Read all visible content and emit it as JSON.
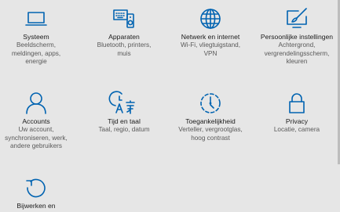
{
  "accent_color": "#0063b1",
  "tiles": [
    {
      "id": "systeem",
      "icon": "laptop-icon",
      "title": "Systeem",
      "desc": [
        "Beeldscherm,",
        "meldingen, apps,",
        "energie"
      ]
    },
    {
      "id": "apparaten",
      "icon": "keyboard-speaker-icon",
      "title": "Apparaten",
      "desc": [
        "Bluetooth, printers,",
        "muis"
      ]
    },
    {
      "id": "netwerk",
      "icon": "globe-icon",
      "title": "Netwerk en internet",
      "desc": [
        "Wi-Fi, vliegtuigstand,",
        "VPN"
      ]
    },
    {
      "id": "persoonlijk",
      "icon": "paint-monitor-icon",
      "title": "Persoonlijke instellingen",
      "desc": [
        "Achtergrond,",
        "vergrendelingsscherm,",
        "kleuren"
      ]
    },
    {
      "id": "accounts",
      "icon": "person-icon",
      "title": "Accounts",
      "desc": [
        "Uw account,",
        "synchroniseren, werk,",
        "andere gebruikers"
      ]
    },
    {
      "id": "tijd",
      "icon": "time-language-icon",
      "title": "Tijd en taal",
      "desc": [
        "Taal, regio, datum"
      ]
    },
    {
      "id": "toegankelijkheid",
      "icon": "ease-of-access-icon",
      "title": "Toegankelijkheid",
      "desc": [
        "Verteller, vergrootglas,",
        "hoog contrast"
      ]
    },
    {
      "id": "privacy",
      "icon": "lock-icon",
      "title": "Privacy",
      "desc": [
        "Locatie, camera"
      ]
    },
    {
      "id": "bijwerken",
      "icon": "refresh-icon",
      "title": "Bijwerken en",
      "desc": []
    }
  ]
}
